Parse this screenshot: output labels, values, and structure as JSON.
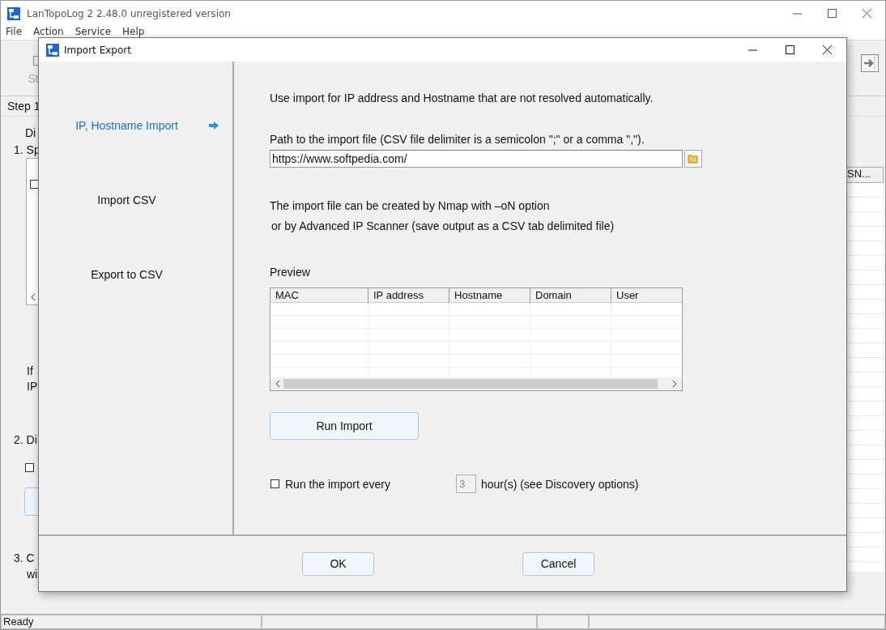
{
  "main_window": {
    "title": "LanTopoLog 2 2.48.0 unregistered version",
    "menu": [
      "File",
      "Action",
      "Service",
      "Help"
    ],
    "toolbar_button": "St",
    "step_header": "Step 1",
    "line_1": "Di",
    "item_1": "1. Sp",
    "list_checkbox": {
      "checked": false
    },
    "note_lines": [
      "If",
      "IP"
    ],
    "item_2": "2. Di",
    "option_checkbox": {
      "checked": false
    },
    "item_3_lines": [
      "3. C",
      "wi"
    ],
    "table_column": "SN..."
  },
  "dialog": {
    "title": "Import Export",
    "nav": [
      {
        "label": "IP, Hostname Import",
        "selected": true
      },
      {
        "label": "Import CSV",
        "selected": false
      },
      {
        "label": "Export to CSV",
        "selected": false
      }
    ],
    "intro": "Use import for IP address and Hostname that are not resolved automatically.",
    "path_label": "Path to the  import file (CSV file delimiter is a semicolon \";\" or a comma \",\").",
    "path_value": "https://www.softpedia.com/",
    "help_lines": [
      "The import file can be created by Nmap with –oN option",
      "or by Advanced IP Scanner (save output as a CSV tab delimited file)"
    ],
    "preview_label": "Preview",
    "preview_columns": [
      "MAC",
      "IP address",
      "Hostname",
      "Domain",
      "User"
    ],
    "run_button": "Run Import",
    "schedule": {
      "label": "Run the import every",
      "checked": false,
      "hours": "3",
      "disabled": true,
      "suffix": "hour(s) (see Discovery options)"
    },
    "buttons": [
      "OK",
      "Cancel"
    ]
  },
  "status_bar": [
    "Ready"
  ]
}
